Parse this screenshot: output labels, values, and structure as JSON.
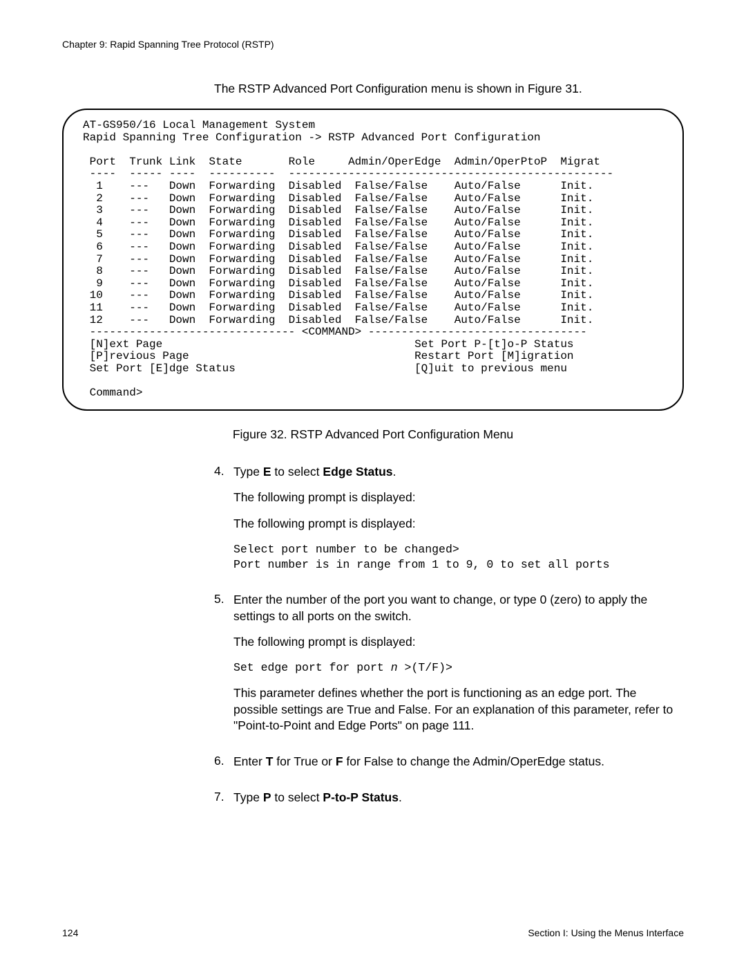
{
  "chapter": "Chapter 9: Rapid Spanning Tree Protocol (RSTP)",
  "intro": "The RSTP Advanced Port Configuration menu is shown in Figure 31.",
  "terminal": {
    "header_line1": "AT-GS950/16 Local Management System",
    "header_line2": "Rapid Spanning Tree Configuration -> RSTP Advanced Port Configuration",
    "col_header": " Port  Trunk Link  State       Role     Admin/OperEdge  Admin/OperPtoP  Migrat",
    "col_rule": " ----  ----- ----  ----------  -------------------------------------------------",
    "rows": [
      "  1    ---   Down  Forwarding  Disabled  False/False    Auto/False      Init.",
      "  2    ---   Down  Forwarding  Disabled  False/False    Auto/False      Init.",
      "  3    ---   Down  Forwarding  Disabled  False/False    Auto/False      Init.",
      "  4    ---   Down  Forwarding  Disabled  False/False    Auto/False      Init.",
      "  5    ---   Down  Forwarding  Disabled  False/False    Auto/False      Init.",
      "  6    ---   Down  Forwarding  Disabled  False/False    Auto/False      Init.",
      "  7    ---   Down  Forwarding  Disabled  False/False    Auto/False      Init.",
      "  8    ---   Down  Forwarding  Disabled  False/False    Auto/False      Init.",
      "  9    ---   Down  Forwarding  Disabled  False/False    Auto/False      Init.",
      " 10    ---   Down  Forwarding  Disabled  False/False    Auto/False      Init.",
      " 11    ---   Down  Forwarding  Disabled  False/False    Auto/False      Init.",
      " 12    ---   Down  Forwarding  Disabled  False/False    Auto/False      Init."
    ],
    "cmd_rule": " ------------------------------- <COMMAND> ---------------------------------",
    "cmd_l1_left": " [N]ext Page",
    "cmd_l1_right": "Set Port P-[t]o-P Status",
    "cmd_l2_left": " [P]revious Page",
    "cmd_l2_right": "Restart Port [M]igration",
    "cmd_l3_left": " Set Port [E]dge Status",
    "cmd_l3_right": "[Q]uit to previous menu",
    "prompt": " Command>"
  },
  "figure_caption": "Figure 32. RSTP Advanced Port Configuration Menu",
  "steps": {
    "s4": {
      "num": "4.",
      "line1_a": "Type ",
      "line1_b": "E",
      "line1_c": " to select ",
      "line1_d": "Edge Status",
      "line1_e": ".",
      "para1": "The following prompt is displayed:",
      "para2": "The following prompt is displayed:",
      "code1": "Select port number to be changed>",
      "code2": "Port number is in range from 1 to 9, 0 to set all ports"
    },
    "s5": {
      "num": "5.",
      "para1": "Enter the number of the port you want to change, or type 0 (zero) to apply the settings to all ports on the switch.",
      "para2": "The following prompt is displayed:",
      "code_a": "Set edge port for port ",
      "code_b": "n",
      "code_c": " >(T/F)>",
      "para3": "This parameter defines whether the port is functioning as an edge port. The possible settings are True and False. For an explanation of this parameter, refer to \"Point-to-Point and Edge Ports\" on page 111."
    },
    "s6": {
      "num": "6.",
      "a": "Enter ",
      "b": "T",
      "c": " for True or ",
      "d": "F",
      "e": " for False to change the Admin/OperEdge status."
    },
    "s7": {
      "num": "7.",
      "a": "Type ",
      "b": "P",
      "c": " to select ",
      "d": "P-to-P Status",
      "e": "."
    }
  },
  "footer": {
    "page": "124",
    "section": "Section I: Using the Menus Interface"
  }
}
